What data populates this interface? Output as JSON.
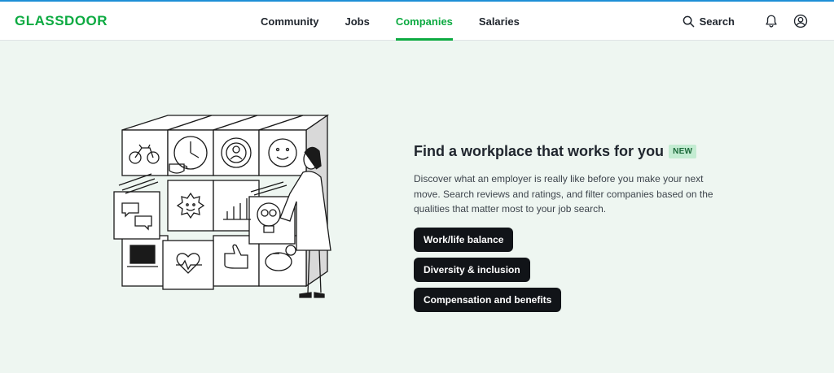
{
  "header": {
    "logo_text": "GLASSDOOR",
    "nav": [
      {
        "label": "Community"
      },
      {
        "label": "Jobs"
      },
      {
        "label": "Companies"
      },
      {
        "label": "Salaries"
      }
    ],
    "active_nav": "Companies",
    "search_label": "Search",
    "icons": [
      "search-icon",
      "bell-icon",
      "user-icon"
    ]
  },
  "hero": {
    "title": "Find a workplace that works for you",
    "badge": "NEW",
    "description": "Discover what an employer is really like before you make your next move. Search reviews and ratings, and filter companies based on the qualities that matter most to your job search.",
    "chips": [
      {
        "label": "Work/life balance"
      },
      {
        "label": "Diversity & inclusion"
      },
      {
        "label": "Compensation and benefits"
      }
    ]
  },
  "colors": {
    "brand_green": "#0caa41",
    "background": "#eef6f1",
    "chip_bg": "#111418",
    "badge_bg": "#c3ecd2"
  }
}
